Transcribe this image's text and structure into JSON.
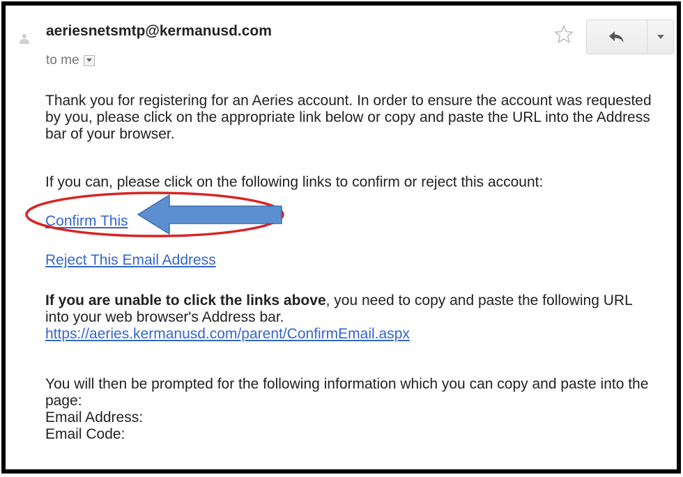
{
  "header": {
    "sender": "aeriesnetsmtp@kermanusd.com",
    "to_label": "to me"
  },
  "message": {
    "paragraph1": "Thank you for registering for an Aeries account. In order to ensure the account was requested by you, please click on the appropriate link below or copy and paste the URL into the Address bar of your browser.",
    "paragraph2": "If you can, please click on the following links to confirm or reject this account:",
    "confirm_link": "Confirm This",
    "reject_link": "Reject This Email Address",
    "unable_bold": "If you are unable to click the links above",
    "unable_rest": ", you need to copy and paste the following URL into your web browser's Address bar.",
    "url_link": "https://aeries.kermanusd.com/parent/ConfirmEmail.aspx",
    "prompt_text": "You will then be prompted for the following information which you can copy and paste into the page:",
    "email_address_label": "Email Address:",
    "email_code_label": "Email Code:"
  },
  "icons": {
    "avatar": "avatar-icon",
    "star": "star-icon",
    "reply": "reply-icon",
    "more": "chevron-down-icon",
    "to_dropdown": "chevron-down-icon"
  },
  "colors": {
    "link": "#3366cc",
    "annotation_ellipse": "#d92323",
    "annotation_arrow": "#5b8fd1"
  }
}
